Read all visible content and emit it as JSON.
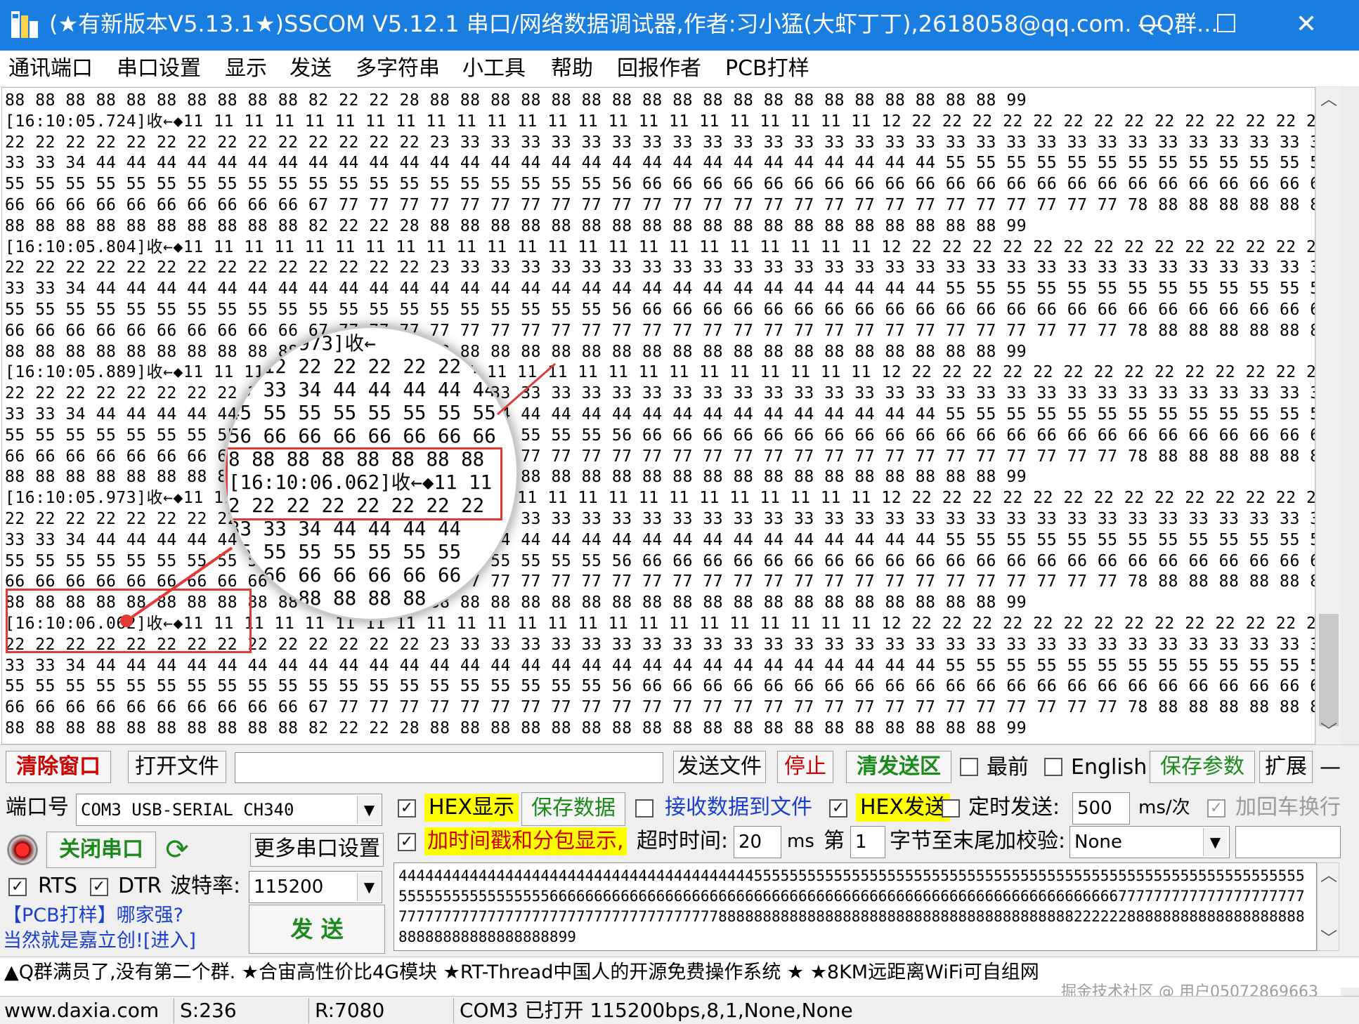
{
  "window": {
    "title": "(★有新版本V5.13.1★)SSCOM V5.12.1 串口/网络数据调试器,作者:习小猛(大虾丁丁),2618058@qq.com. QQ群...",
    "minimize_glyph": "—",
    "maximize_glyph": "☐",
    "close_glyph": "✕",
    "icon": "sscom-app-icon"
  },
  "menu": [
    "通讯端口",
    "串口设置",
    "显示",
    "发送",
    "多字符串",
    "小工具",
    "帮助",
    "回报作者",
    "PCB打样"
  ],
  "receive": {
    "lines": [
      "88 88 88 88 88 88 88 88 88 88 82 22 22 28 88 88 88 88 88 88 88 88 88 88 88 88 88 88 88 88 88 88 88 99",
      "[16:10:05.724]收←◆11 11 11 11 11 11 11 11 11 11 11 11 11 11 11 11 11 11 11 11 11 11 11 12 22 22 22 22 22 22 22 22 22 22 22 22 22 22",
      "22 22 22 22 22 22 22 22 22 22 22 22 22 22 23 33 33 33 33 33 33 33 33 33 33 33 33 33 33 33 33 33 33 33 33 33 33 33 33 33 33 33 33 33",
      "33 33 34 44 44 44 44 44 44 44 44 44 44 44 44 44 44 44 44 44 44 44 44 44 44 44 44 44 44 44 44 55 55 55 55 55 55 55 55 55 55 55 55 55",
      "55 55 55 55 55 55 55 55 55 55 55 55 55 55 55 55 55 55 55 55 56 66 66 66 66 66 66 66 66 66 66 66 66 66 66 66 66 66 66 66 66 66 66 66",
      "66 66 66 66 66 66 66 66 66 66 67 77 77 77 77 77 77 77 77 77 77 77 77 77 77 77 77 77 77 77 77 77 77 77 77 77 77 78 88 88 88 88 88 88",
      "88 88 88 88 88 88 88 88 88 88 82 22 22 28 88 88 88 88 88 88 88 88 88 88 88 88 88 88 88 88 88 88 88 99",
      "[16:10:05.804]收←◆11 11 11 11 11 11 11 11 11 11 11 11 11 11 11 11 11 11 11 11 11 11 11 12 22 22 22 22 22 22 22 22 22 22 22 22 22 22",
      "22 22 22 22 22 22 22 22 22 22 22 22 22 22 23 33 33 33 33 33 33 33 33 33 33 33 33 33 33 33 33 33 33 33 33 33 33 33 33 33 33 33 33 33",
      "33 33 34 44 44 44 44 44 44 44 44 44 44 44 44 44 44 44 44 44 44 44 44 44 44 44 44 44 44 44 44 55 55 55 55 55 55 55 55 55 55 55 55 55",
      "55 55 55 55 55 55 55 55 55 55 55 55 55 55 55 55 55 55 55 55 56 66 66 66 66 66 66 66 66 66 66 66 66 66 66 66 66 66 66 66 66 66 66 66",
      "66 66 66 66 66 66 66 66 66 66 67 77 77 77 77 77 77 77 77 77 77 77 77 77 77 77 77 77 77 77 77 77 77 77 77 77 77 78 88 88 88 88 88 88",
      "88 88 88 88 88 88 88 88 88 88 82 22 22 28 88 88 88 88 88 88 88 88 88 88 88 88 88 88 88 88 88 88 88 99",
      "[16:10:05.889]收←◆11 11 11 11 11 11 11 11 11 11 11 11 11 11 11 11 11 11 11 11 11 11 11 12 22 22 22 22 22 22 22 22 22 22 22 22 22 22",
      "22 22 22 22 22 22 22 22 22 22 22 22 22 22 23 33 33 33 33 33 33 33 33 33 33 33 33 33 33 33 33 33 33 33 33 33 33 33 33 33 33 33 33 33",
      "33 33 34 44 44 44 44 44 44 44 44 44 44 44 44 44 44 44 44 44 44 44 44 44 44 44 44 44 44 44 44 55 55 55 55 55 55 55 55 55 55 55 55 55",
      "55 55 55 55 55 55 55 55 55 55 55 55 55 55 55 55 55 55 55 55 56 66 66 66 66 66 66 66 66 66 66 66 66 66 66 66 66 66 66 66 66 66 66 66",
      "66 66 66 66 66 66 66 66 66 66 67 77 77 77 77 77 77 77 77 77 77 77 77 77 77 77 77 77 77 77 77 77 77 77 77 77 77 78 88 88 88 88 88 88",
      "88 88 88 88 88 88 88 88 88 88 82 22 22 28 88 88 88 88 88 88 88 88 88 88 88 88 88 88 88 88 88 88 88 99",
      "[16:10:05.973]收←◆11 11 11 11 11 11 11 11 11 11 11 11 11 11 11 11 11 11 11 11 11 11 11 12 22 22 22 22 22 22 22 22 22 22 22 22 22 22",
      "22 22 22 22 22 22 22 22 22 22 22 22 22 22 23 33 33 33 33 33 33 33 33 33 33 33 33 33 33 33 33 33 33 33 33 33 33 33 33 33 33 33 33 33",
      "33 33 34 44 44 44 44 44 44 44 44 44 44 44 44 44 44 44 44 44 44 44 44 44 44 44 44 44 44 44 44 55 55 55 55 55 55 55 55 55 55 55 55 55",
      "55 55 55 55 55 55 55 55 55 55 55 55 55 55 55 55 55 55 55 55 56 66 66 66 66 66 66 66 66 66 66 66 66 66 66 66 66 66 66 66 66 66 66 66",
      "66 66 66 66 66 66 66 66 66 66 67 77 77 77 77 77 77 77 77 77 77 77 77 77 77 77 77 77 77 77 77 77 77 77 77 77 77 78 88 88 88 88 88 88",
      "88 88 88 88 88 88 88 88 88 88 82 22 22 28 88 88 88 88 88 88 88 88 88 88 88 88 88 88 88 88 88 88 88 99",
      "[16:10:06.062]收←◆11 11 11 11 11 11 11 11 11 11 11 11 11 11 11 11 11 11 11 11 11 11 11 12 22 22 22 22 22 22 22 22 22 22 22 22 22 22",
      "22 22 22 22 22 22 22 22 22 22 22 22 22 22 23 33 33 33 33 33 33 33 33 33 33 33 33 33 33 33 33 33 33 33 33 33 33 33 33 33 33 33 33 33",
      "33 33 34 44 44 44 44 44 44 44 44 44 44 44 44 44 44 44 44 44 44 44 44 44 44 44 44 44 44 44 44 55 55 55 55 55 55 55 55 55 55 55 55 55",
      "55 55 55 55 55 55 55 55 55 55 55 55 55 55 55 55 55 55 55 55 56 66 66 66 66 66 66 66 66 66 66 66 66 66 66 66 66 66 66 66 66 66 66 66",
      "66 66 66 66 66 66 66 66 66 66 67 77 77 77 77 77 77 77 77 77 77 77 77 77 77 77 77 77 77 77 77 77 77 77 77 77 77 78 88 88 88 88 88 88",
      "88 88 88 88 88 88 88 88 88 88 82 22 22 28 88 88 88 88 88 88 88 88 88 88 88 88 88 88 88 88 88 88 88 99"
    ],
    "magnifier_lines": [
      "   05.973]收←",
      "11 12 22 22 22 22 22 2",
      "23 33 34 44 44 44 44 44",
      "45 55 55 55 55 55 55 55",
      "56 66 66 66 66 66 66 66",
      "8 88 88 88 88 88 88 88",
      "[16:10:06.062]收←◆11 11",
      "2 22 22 22 22 22 22 22",
      "33 33 34 44 44 44 44",
      "55 55 55 55 55 55 55",
      "66 66 66 66 66 66 66",
      "88 88 88 88 88 88"
    ]
  },
  "toolbar": {
    "clear_window": "清除窗口",
    "open_file": "打开文件",
    "file_path": "",
    "send_file": "发送文件",
    "stop": "停止",
    "clear_send": "清发送区",
    "topmost_label": "最前",
    "english_label": "English",
    "save_params": "保存参数",
    "expand": "扩展",
    "dash": "—"
  },
  "port": {
    "port_label": "端口号",
    "port_value": "COM3 USB-SERIAL CH340",
    "close_port": "关闭串口",
    "more_settings": "更多串口设置",
    "rts_label": "RTS",
    "dtr_label": "DTR",
    "baud_label": "波特率:",
    "baud_value": "115200"
  },
  "options": {
    "hex_display": "HEX显示",
    "save_data": "保存数据",
    "recv_to_file": "接收数据到文件",
    "hex_send": "HEX发送",
    "timed_send": "定时发送:",
    "interval_value": "500",
    "interval_unit": "ms/次",
    "append_crlf": "加回车换行",
    "timestamp": "加时间戳和分包显示,",
    "timeout_label": "超时时间:",
    "timeout_value": "20",
    "timeout_unit": "ms",
    "di_label": "第",
    "byte_value": "1",
    "checksum_label": "字节至末尾加校验:",
    "checksum_value": "None"
  },
  "ad": {
    "line1": "【PCB打样】哪家强?",
    "line2": "当然就是嘉立创![进入]"
  },
  "send_button": "发  送",
  "send_buffer": "44444444444444444444444444444444444444445555555555555555555555555555555555555555555555555555555555555555555555555555555666666666666666666666666666666666666666666666666666666666666666677777777777777777777777777777777777777777777777777777777788888888888888888888888888888888888888882222228888888888888888888888888888888888888899",
  "marquee": "▲Q群满员了,没有第二个群. ★合宙高性价比4G模块 ★RT-Thread中国人的开源免费操作系统 ★ ★8KM远距离WiFi可自组网",
  "watermark": "掘金技术社区 @ 用户05072869663",
  "status": {
    "website": "www.daxia.com",
    "sent": "S:236",
    "received": "R:7080",
    "port_state": "COM3 已打开  115200bps,8,1,None,None"
  },
  "colors": {
    "titlebar": "#1a7ee0",
    "highlight_yellow": "#ffff00",
    "red_text": "#d00000",
    "green_text": "#1a8a1a",
    "annotation_red": "#e53935"
  }
}
